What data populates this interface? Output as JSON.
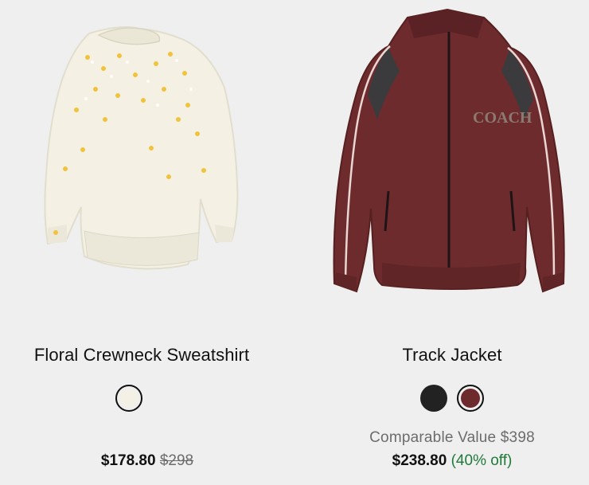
{
  "products": [
    {
      "name": "Floral Crewneck Sweatshirt",
      "image_icon": "floral-sweatshirt-image",
      "swatches": [
        {
          "label": "Chalk",
          "color": "#f3f0e6",
          "selected": true
        }
      ],
      "sale_price": "$178.80",
      "original_price": "$298"
    },
    {
      "name": "Track Jacket",
      "image_icon": "track-jacket-image",
      "swatches": [
        {
          "label": "Black",
          "color": "#222222",
          "selected": false
        },
        {
          "label": "Burgundy",
          "color": "#6e2b2e",
          "selected": true
        }
      ],
      "comparable_value": "Comparable Value $398",
      "sale_price": "$238.80",
      "discount": "(40% off)"
    }
  ],
  "colors": {
    "background": "#f0efef",
    "discount_green": "#1f7a3a",
    "muted_text": "#6c6c6c"
  }
}
